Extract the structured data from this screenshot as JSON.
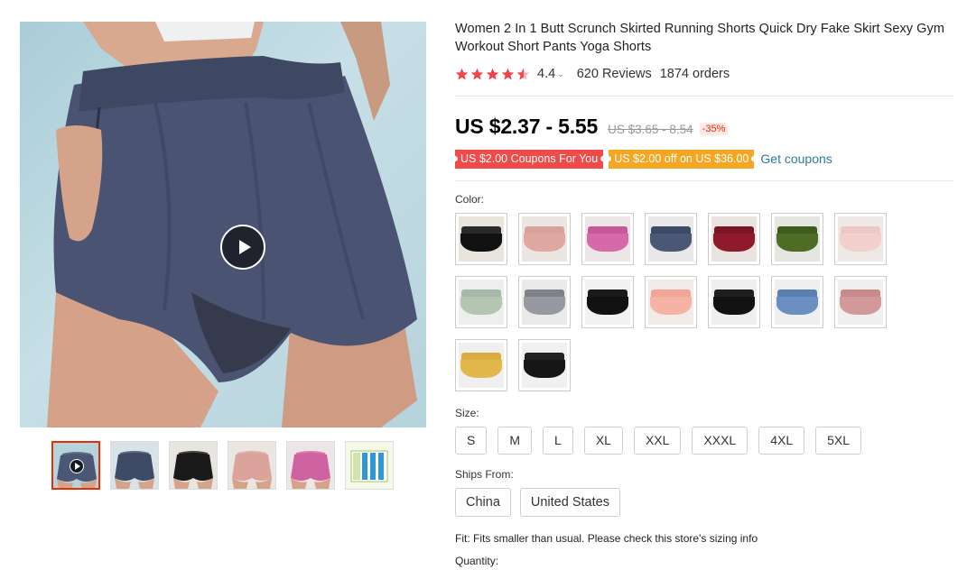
{
  "product": {
    "title": "Women 2 In 1 Butt Scrunch Skirted Running Shorts Quick Dry Fake Skirt Sexy Gym Workout Short Pants Yoga Shorts",
    "rating_value": "4.4",
    "reviews": "620 Reviews",
    "orders": "1874 orders",
    "price": "US $2.37 - 5.55",
    "old_price": "US $3.65 - 8.54",
    "discount": "-35%"
  },
  "coupons": {
    "store_coupon": "US $2.00 Coupons For You",
    "off_coupon": "US $2.00 off on US $36.00",
    "get_link": "Get coupons"
  },
  "labels": {
    "color": "Color:",
    "size": "Size:",
    "ships_from": "Ships From:",
    "fit": "Fit: Fits smaller than usual. Please check this store's sizing info",
    "quantity": "Quantity:"
  },
  "sizes": [
    "S",
    "M",
    "L",
    "XL",
    "XXL",
    "XXXL",
    "4XL",
    "5XL"
  ],
  "ships_from": [
    "China",
    "United States"
  ],
  "color_swatches": [
    {
      "name": "black-shorts",
      "band": "#2a2a2a",
      "body": "#111111",
      "bg": "#e9e4de"
    },
    {
      "name": "pink-shorts",
      "band": "#d9a39d",
      "body": "#e0a8a0",
      "bg": "#ece6e3"
    },
    {
      "name": "rose-pink-shorts",
      "band": "#c6589a",
      "body": "#d66aa9",
      "bg": "#ece6e6"
    },
    {
      "name": "navy-shorts",
      "band": "#3d4a66",
      "body": "#4a5775",
      "bg": "#e8e8e8"
    },
    {
      "name": "wine-red-shorts",
      "band": "#7a1624",
      "body": "#8e1a2c",
      "bg": "#eae4e1"
    },
    {
      "name": "army-green-shorts",
      "band": "#3e5c1f",
      "body": "#4d6d27",
      "bg": "#e6e6e0"
    },
    {
      "name": "light-pink-shorts",
      "band": "#eec8c6",
      "body": "#f2d0cc",
      "bg": "#efe9e6"
    },
    {
      "name": "sage-green-shorts",
      "band": "#a6b9a6",
      "body": "#b4c6b1",
      "bg": "#eeeeee"
    },
    {
      "name": "grey-shorts",
      "band": "#7e8186",
      "body": "#969aa0",
      "bg": "#eaeaea"
    },
    {
      "name": "black-2-shorts",
      "band": "#1b1b1b",
      "body": "#111111",
      "bg": "#f2f2f2"
    },
    {
      "name": "peach-shorts",
      "band": "#f0a596",
      "body": "#f4b3a4",
      "bg": "#f1ece9"
    },
    {
      "name": "black-3-shorts",
      "band": "#1f1f1f",
      "body": "#121212",
      "bg": "#efefef"
    },
    {
      "name": "blue-shorts",
      "band": "#5b7fb0",
      "body": "#6a8fc0",
      "bg": "#efefef"
    },
    {
      "name": "dusty-pink-shorts",
      "band": "#c98a8b",
      "body": "#d3999a",
      "bg": "#efefef"
    },
    {
      "name": "yellow-shorts",
      "band": "#d9ac40",
      "body": "#e2b84c",
      "bg": "#efefef"
    },
    {
      "name": "black-4-shorts",
      "band": "#222222",
      "body": "#161616",
      "bg": "#f0f0f0"
    }
  ],
  "thumbnails": [
    {
      "name": "thumb-video-navy",
      "color": "#4a5775",
      "bg": "#b6d3dc"
    },
    {
      "name": "thumb-navy",
      "color": "#3e4a66",
      "bg": "#d7e3e8"
    },
    {
      "name": "thumb-black",
      "color": "#1a1a1a",
      "bg": "#e8e4df"
    },
    {
      "name": "thumb-pink",
      "color": "#dba39b",
      "bg": "#ece6e3"
    },
    {
      "name": "thumb-rose",
      "color": "#cf63a2",
      "bg": "#ece6e6"
    },
    {
      "name": "thumb-size-chart",
      "color": "#2f97d8",
      "bg": "#f4f9e8"
    }
  ],
  "colors": {
    "accent_red": "#e62e04",
    "star": "#f0434c",
    "link": "#2e7a9b",
    "coupon_red": "#f04a49",
    "coupon_orange": "#f5a623"
  }
}
